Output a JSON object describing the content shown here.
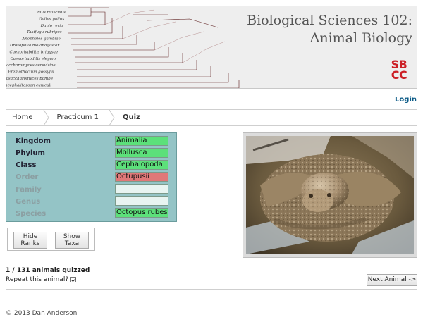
{
  "banner": {
    "title_line1": "Biological Sciences 102:",
    "title_line2": "Animal Biology",
    "logo_line1": "SB",
    "logo_line2": "CC",
    "tree_labels": [
      "Mus musculus",
      "Gallus gallus",
      "Danio rerio",
      "Takifugu rubripes",
      "Anopheles gambiae",
      "Drosophila melanogaster",
      "Caenorhabditis briggsae",
      "Caenorhabditis elegans",
      "Saccharomyces cerevisiae",
      "Eremothecium gossypii",
      "Schizosaccharomyces pombe",
      "Encephalitozoon cuniculi"
    ]
  },
  "header": {
    "login_label": "Login"
  },
  "breadcrumb": {
    "items": [
      {
        "label": "Home"
      },
      {
        "label": "Practicum 1"
      },
      {
        "label": "Quiz"
      }
    ]
  },
  "quiz": {
    "ranks": [
      {
        "label": "Kingdom",
        "answer": "Animalia",
        "state": "correct",
        "active": true
      },
      {
        "label": "Phylum",
        "answer": "Mollusca",
        "state": "correct",
        "active": true
      },
      {
        "label": "Class",
        "answer": "Cephalopoda",
        "state": "correct",
        "active": true
      },
      {
        "label": "Order",
        "answer": "Octupusii",
        "state": "wrong",
        "active": false
      },
      {
        "label": "Family",
        "answer": "",
        "state": "empty",
        "active": false
      },
      {
        "label": "Genus",
        "answer": "",
        "state": "empty",
        "active": false
      },
      {
        "label": "Species",
        "answer": "Octopus rubescens",
        "state": "correct",
        "active": false
      }
    ],
    "hide_ranks_label": "Hide Ranks",
    "show_taxa_label": "Show Taxa",
    "status_text": "1 / 131 animals quizzed",
    "repeat_label": "Repeat this animal?",
    "repeat_checked": true,
    "next_label": "Next Animal ->"
  },
  "colors": {
    "correct": "#5ce07a",
    "wrong": "#e07878",
    "panel": "#94c4c6",
    "logo": "#cc1f26",
    "link": "#0a5a86"
  },
  "footer": {
    "text": "© 2013 Dan Anderson"
  }
}
